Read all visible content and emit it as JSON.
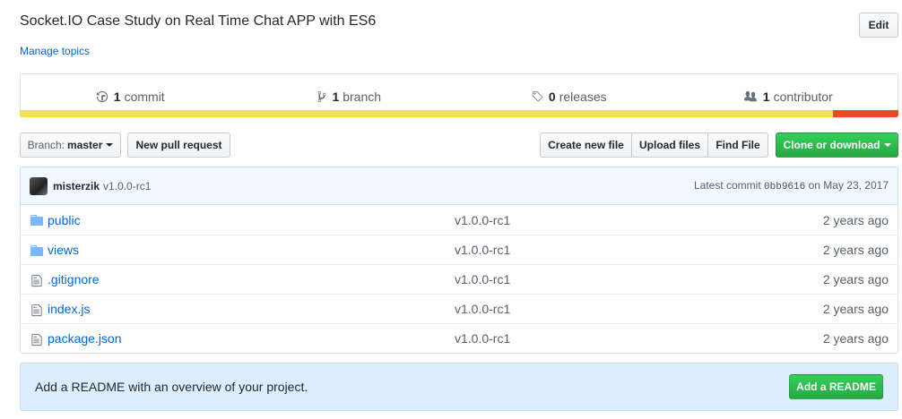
{
  "repo": {
    "description": "Socket.IO Case Study on Real Time Chat APP with ES6",
    "manage_topics": "Manage topics",
    "edit_label": "Edit"
  },
  "summary": {
    "commits": {
      "count": "1",
      "label": "commit",
      "icon": "history-icon"
    },
    "branches": {
      "count": "1",
      "label": "branch",
      "icon": "git-branch-icon"
    },
    "releases": {
      "count": "0",
      "label": "releases",
      "icon": "tag-icon"
    },
    "contributors": {
      "count": "1",
      "label": "contributor",
      "icon": "people-icon"
    }
  },
  "languages": {
    "colors": [
      "#f1e05a",
      "#e34c26"
    ]
  },
  "toolbar": {
    "branch_prefix": "Branch:",
    "branch_name": "master",
    "new_pull_request": "New pull request",
    "create_new_file": "Create new file",
    "upload_files": "Upload files",
    "find_file": "Find File",
    "clone_or_download": "Clone or download"
  },
  "latest_commit": {
    "author": "misterzik",
    "message": "v1.0.0-rc1",
    "prefix": "Latest commit",
    "sha": "0bb9616",
    "date": "on May 23, 2017"
  },
  "files": [
    {
      "type": "dir",
      "name": "public",
      "message": "v1.0.0-rc1",
      "age": "2 years ago"
    },
    {
      "type": "dir",
      "name": "views",
      "message": "v1.0.0-rc1",
      "age": "2 years ago"
    },
    {
      "type": "file",
      "name": ".gitignore",
      "message": "v1.0.0-rc1",
      "age": "2 years ago"
    },
    {
      "type": "file",
      "name": "index.js",
      "message": "v1.0.0-rc1",
      "age": "2 years ago"
    },
    {
      "type": "file",
      "name": "package.json",
      "message": "v1.0.0-rc1",
      "age": "2 years ago"
    }
  ],
  "readme_prompt": {
    "text": "Add a README with an overview of your project.",
    "button": "Add a README"
  }
}
